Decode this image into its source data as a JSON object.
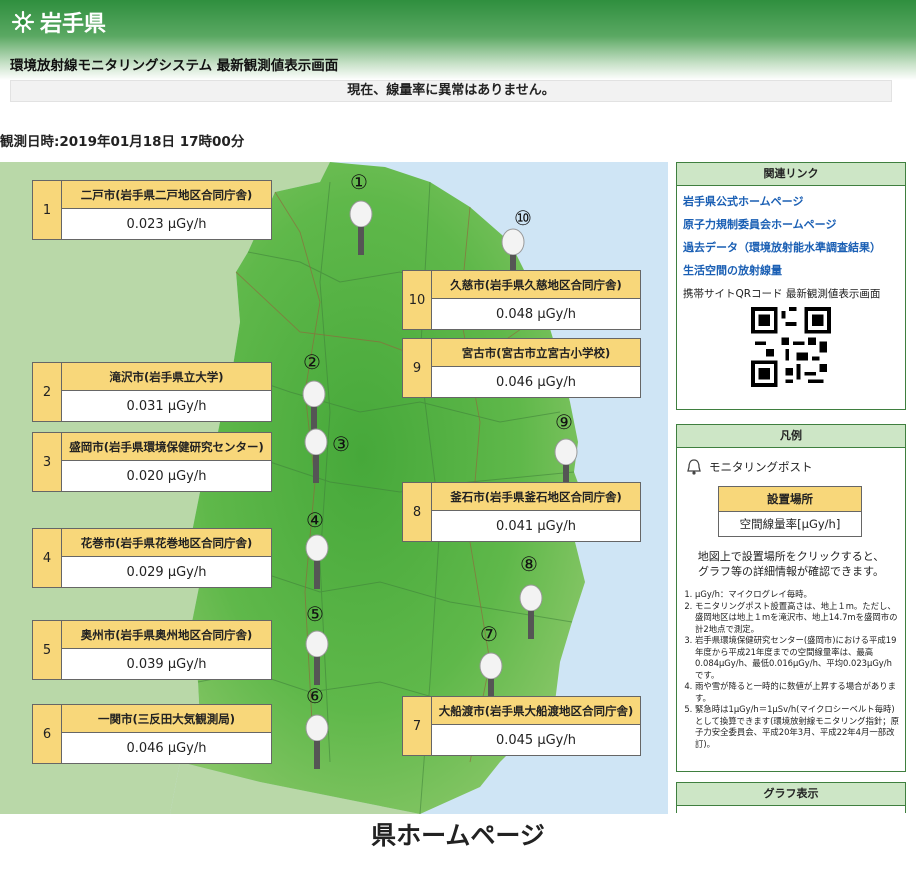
{
  "header": {
    "logo_text": "岩手県",
    "system_title": "環境放射線モニタリングシステム 最新観測値表示画面",
    "status_message": "現在、線量率に異常はありません。",
    "observation_time": "観測日時:2019年01月18日 17時00分"
  },
  "sites": [
    {
      "num": "1",
      "name": "二戸市(岩手県二戸地区合同庁舎)",
      "value": "0.023 μGy/h"
    },
    {
      "num": "2",
      "name": "滝沢市(岩手県立大学)",
      "value": "0.031 μGy/h"
    },
    {
      "num": "3",
      "name": "盛岡市(岩手県環境保健研究センター)",
      "value": "0.020 μGy/h"
    },
    {
      "num": "4",
      "name": "花巻市(岩手県花巻地区合同庁舎)",
      "value": "0.029 μGy/h"
    },
    {
      "num": "5",
      "name": "奥州市(岩手県奥州地区合同庁舎)",
      "value": "0.039 μGy/h"
    },
    {
      "num": "6",
      "name": "一関市(三反田大気観測局)",
      "value": "0.046 μGy/h"
    },
    {
      "num": "7",
      "name": "大船渡市(岩手県大船渡地区合同庁舎)",
      "value": "0.045 μGy/h"
    },
    {
      "num": "8",
      "name": "釜石市(岩手県釜石地区合同庁舎)",
      "value": "0.041 μGy/h"
    },
    {
      "num": "9",
      "name": "宮古市(宮古市立宮古小学校)",
      "value": "0.046 μGy/h"
    },
    {
      "num": "10",
      "name": "久慈市(岩手県久慈地区合同庁舎)",
      "value": "0.048 μGy/h"
    }
  ],
  "post_markers": [
    "①",
    "②",
    "③",
    "④",
    "⑤",
    "⑥",
    "⑦",
    "⑧",
    "⑨",
    "⑩"
  ],
  "related_links": {
    "heading": "関連リンク",
    "links": [
      "岩手県公式ホームページ",
      "原子力規制委員会ホームページ",
      "過去データ（環境放射能水準調査結果）",
      "生活空間の放射線量"
    ],
    "qr_label": "携帯サイトQRコード 最新観測値表示画面"
  },
  "legend": {
    "heading": "凡例",
    "post_label": "モニタリングポスト",
    "box_title": "設置場所",
    "box_value": "空間線量率[μGy/h]",
    "instruction_1": "地図上で設置場所をクリックすると、",
    "instruction_2": "グラフ等の詳細情報が確認できます。",
    "notes": [
      "μGy/h：マイクログレイ毎時。",
      "モニタリングポスト設置高さは、地上１m。ただし、盛岡地区は地上１mを滝沢市、地上14.7mを盛岡市の計2地点で測定。",
      "岩手県環境保健研究センター(盛岡市)における平成19年度から平成21年度までの空間線量率は、最高0.084μGy/h、最低0.016μGy/h、平均0.023μGy/hです。",
      "雨や雪が降ると一時的に数値が上昇する場合があります。",
      "緊急時は1μGy/h＝1μSv/h(マイクロシーベルト毎時)として換算できます(環境放射線モニタリング指針；原子力安全委員会、平成20年3月、平成22年4月一部改訂)。"
    ]
  },
  "graph_panel": {
    "heading": "グラフ表示"
  },
  "footer_caption": "県ホームページ",
  "colors": {
    "header_green": "#2f8f3e",
    "site_label_bg": "#f8d77a",
    "map_land": "#5fb84a",
    "sea": "#cfe5f5",
    "link_blue": "#1a5fb4"
  }
}
